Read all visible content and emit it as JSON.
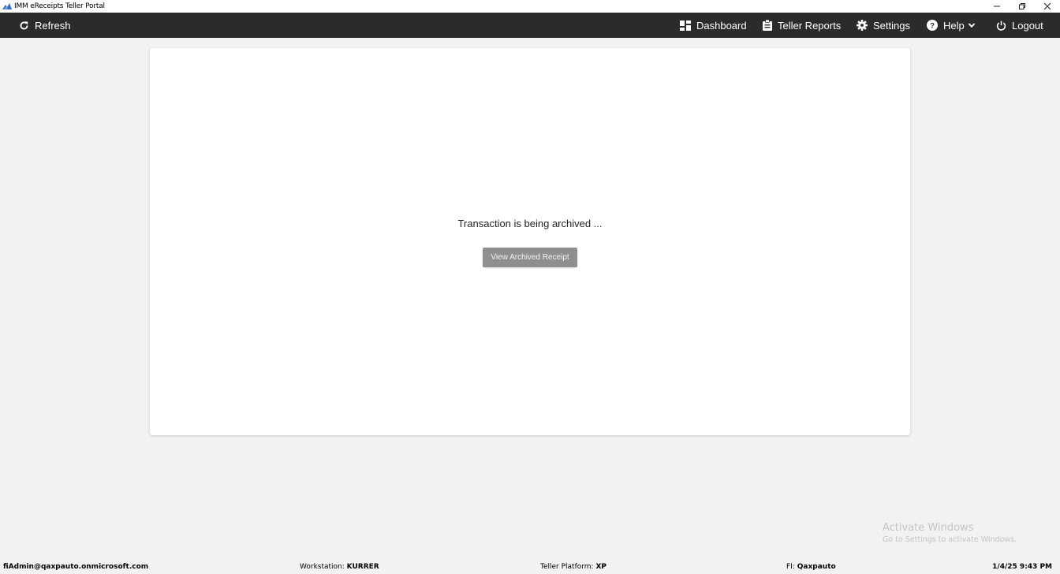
{
  "window": {
    "title": "IMM eReceipts Teller Portal",
    "minimize_icon": "minimize-icon",
    "restore_icon": "restore-icon",
    "close_icon": "close-icon"
  },
  "toolbar": {
    "refresh_label": "Refresh",
    "dashboard_label": "Dashboard",
    "teller_reports_label": "Teller Reports",
    "settings_label": "Settings",
    "help_label": "Help",
    "logout_label": "Logout",
    "background_color": "#2b2b2b"
  },
  "main": {
    "status_message": "Transaction is being archived ...",
    "view_archived_button_label": "View Archived Receipt"
  },
  "watermark": {
    "line1": "Activate Windows",
    "line2": "Go to Settings to activate Windows."
  },
  "footer": {
    "user": "fiAdmin@qaxpauto.onmicrosoft.com",
    "workstation_label": "Workstation:",
    "workstation_value": "KURRER",
    "teller_platform_label": "Teller Platform:",
    "teller_platform_value": "XP",
    "fi_label": "FI:",
    "fi_value": "Qaxpauto",
    "datetime": "1/4/25 9:43 PM"
  }
}
